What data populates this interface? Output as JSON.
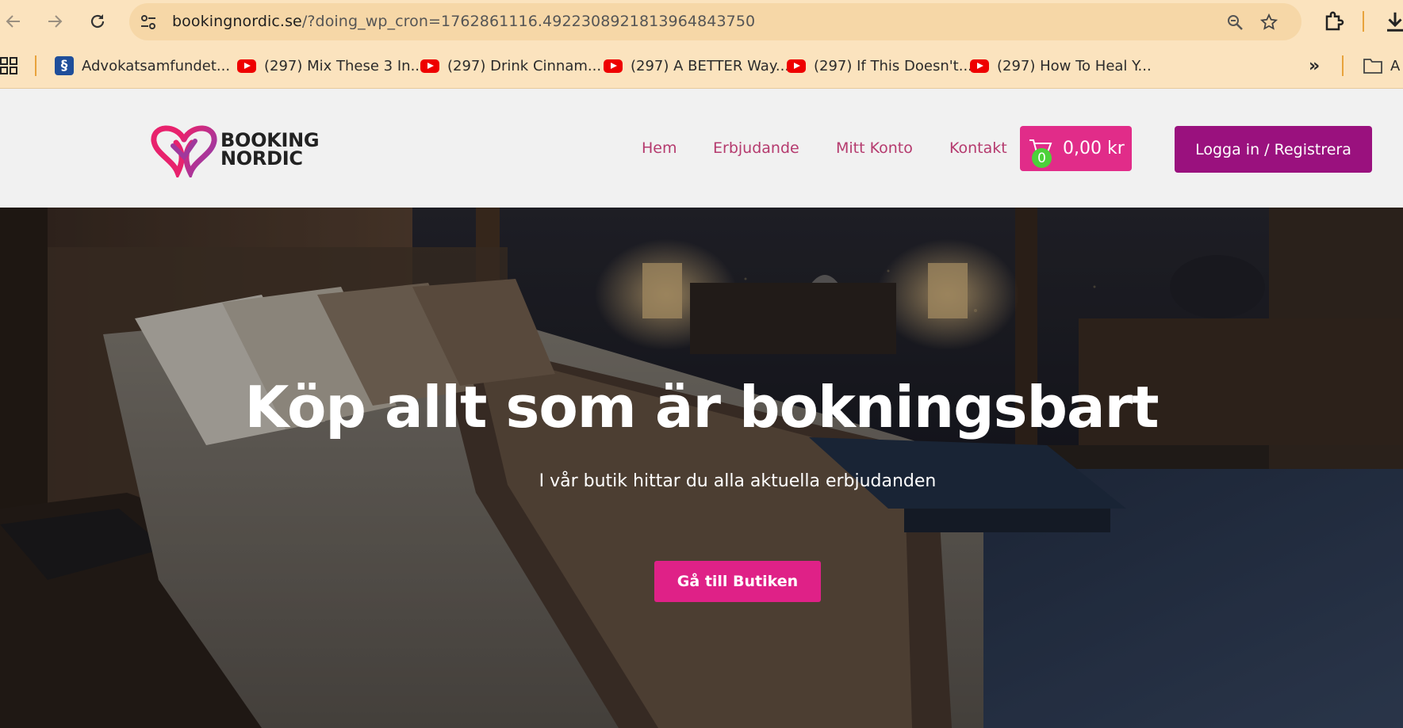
{
  "browser": {
    "url_host": "bookingnordic.se",
    "url_path": "/?doing_wp_cron=1762861116.4922308921813964843750",
    "bookmarks": [
      {
        "icon": "advokatsamfundet-icon",
        "label": "Advokatsamfundet..."
      },
      {
        "icon": "youtube-icon",
        "label": "(297) Mix These 3 In..."
      },
      {
        "icon": "youtube-icon",
        "label": "(297) Drink Cinnam..."
      },
      {
        "icon": "youtube-icon",
        "label": "(297) A BETTER Way..."
      },
      {
        "icon": "youtube-icon",
        "label": "(297) If This Doesn't..."
      },
      {
        "icon": "youtube-icon",
        "label": "(297) How To Heal Y..."
      }
    ],
    "overflow_label": "»",
    "folder_label": "A"
  },
  "site": {
    "logo_line1": "BOOKING",
    "logo_line2": "NORDIC",
    "nav": {
      "home": "Hem",
      "offers": "Erbjudande",
      "account": "Mitt Konto",
      "contact": "Kontakt"
    },
    "cart": {
      "count": "0",
      "total": "0,00 kr"
    },
    "login_label": "Logga in / Registrera"
  },
  "hero": {
    "title": "Köp allt som är bokningsbart",
    "subtitle": "I vår butik hittar du alla aktuella erbjudanden",
    "cta_label": "Gå till Butiken"
  },
  "colors": {
    "chrome": "#fbe3be",
    "brand_pink": "#e12c89",
    "brand_purple": "#9a117e",
    "nav_text": "#b53a6e"
  }
}
